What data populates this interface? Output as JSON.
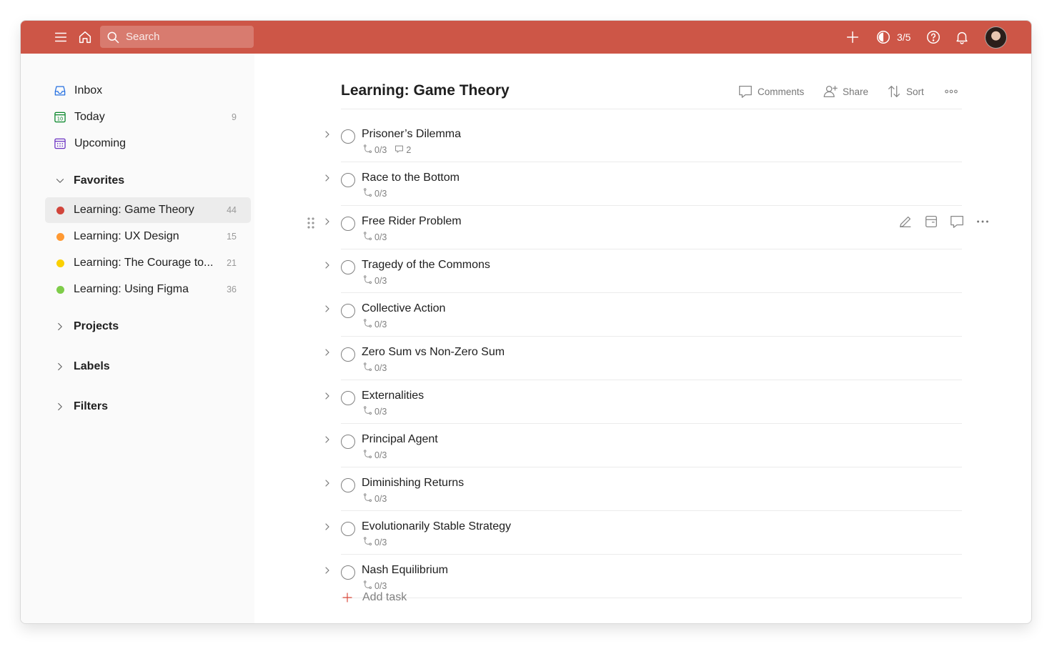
{
  "topbar": {
    "search_placeholder": "Search",
    "karma": "3/5",
    "accent_color": "#cd5647"
  },
  "sidebar": {
    "nav": [
      {
        "label": "Inbox",
        "count": "",
        "icon": "inbox-icon"
      },
      {
        "label": "Today",
        "count": "9",
        "icon": "calendar-today-icon"
      },
      {
        "label": "Upcoming",
        "count": "",
        "icon": "calendar-grid-icon"
      }
    ],
    "favorites_title": "Favorites",
    "favorites": [
      {
        "label": "Learning: Game Theory",
        "count": "44",
        "color": "#d1453b"
      },
      {
        "label": "Learning: UX Design",
        "count": "15",
        "color": "#ff9933"
      },
      {
        "label": "Learning: The Courage to...",
        "count": "21",
        "color": "#fad000"
      },
      {
        "label": "Learning: Using Figma",
        "count": "36",
        "color": "#7ecc49"
      }
    ],
    "sections": [
      "Projects",
      "Labels",
      "Filters"
    ]
  },
  "main": {
    "title": "Learning: Game Theory",
    "actions": {
      "comments": "Comments",
      "share": "Share",
      "sort": "Sort"
    },
    "tasks": [
      {
        "name": "Prisoner’s Dilemma",
        "subtasks": "0/3",
        "comments": "2"
      },
      {
        "name": "Race to the Bottom",
        "subtasks": "0/3",
        "comments": ""
      },
      {
        "name": "Free Rider Problem",
        "subtasks": "0/3",
        "comments": ""
      },
      {
        "name": "Tragedy of the Commons",
        "subtasks": "0/3",
        "comments": ""
      },
      {
        "name": "Collective Action",
        "subtasks": "0/3",
        "comments": ""
      },
      {
        "name": "Zero Sum vs Non-Zero Sum",
        "subtasks": "0/3",
        "comments": ""
      },
      {
        "name": "Externalities",
        "subtasks": "0/3",
        "comments": ""
      },
      {
        "name": "Principal Agent",
        "subtasks": "0/3",
        "comments": ""
      },
      {
        "name": "Diminishing Returns",
        "subtasks": "0/3",
        "comments": ""
      },
      {
        "name": "Evolutionarily Stable Strategy",
        "subtasks": "0/3",
        "comments": ""
      },
      {
        "name": "Nash Equilibrium",
        "subtasks": "0/3",
        "comments": ""
      }
    ],
    "add_task": "Add task"
  }
}
